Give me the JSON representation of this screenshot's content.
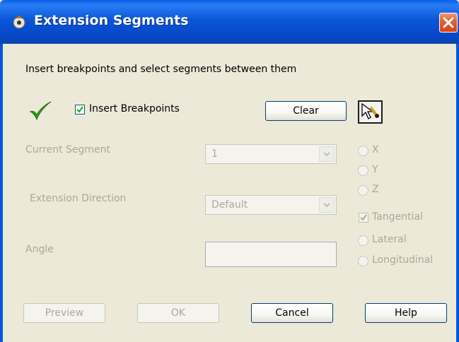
{
  "window": {
    "title": "Extension Segments"
  },
  "instruction": "Insert breakpoints and select segments between them",
  "insert_breakpoints": {
    "label": "Insert Breakpoints",
    "checked": true
  },
  "buttons": {
    "clear": "Clear",
    "preview": "Preview",
    "ok": "OK",
    "cancel": "Cancel",
    "help": "Help"
  },
  "fields": {
    "current_segment": {
      "label": "Current Segment",
      "value": "1"
    },
    "extension_direction": {
      "label": "Extension Direction",
      "value": "Default"
    },
    "angle": {
      "label": "Angle",
      "value": ""
    }
  },
  "options": [
    {
      "label": "X",
      "type": "radio",
      "checked": false
    },
    {
      "label": "Y",
      "type": "radio",
      "checked": false
    },
    {
      "label": "Z",
      "type": "radio",
      "checked": false
    },
    {
      "label": "Tangential",
      "type": "checkbox",
      "checked": true
    },
    {
      "label": "Lateral",
      "type": "radio",
      "checked": false
    },
    {
      "label": "Longitudinal",
      "type": "radio",
      "checked": false
    }
  ],
  "colors": {
    "title_bar": "#0a56d8",
    "dialog_bg": "#ece9d8",
    "disabled_text": "#aca899",
    "check_green": "#2fa11a"
  }
}
